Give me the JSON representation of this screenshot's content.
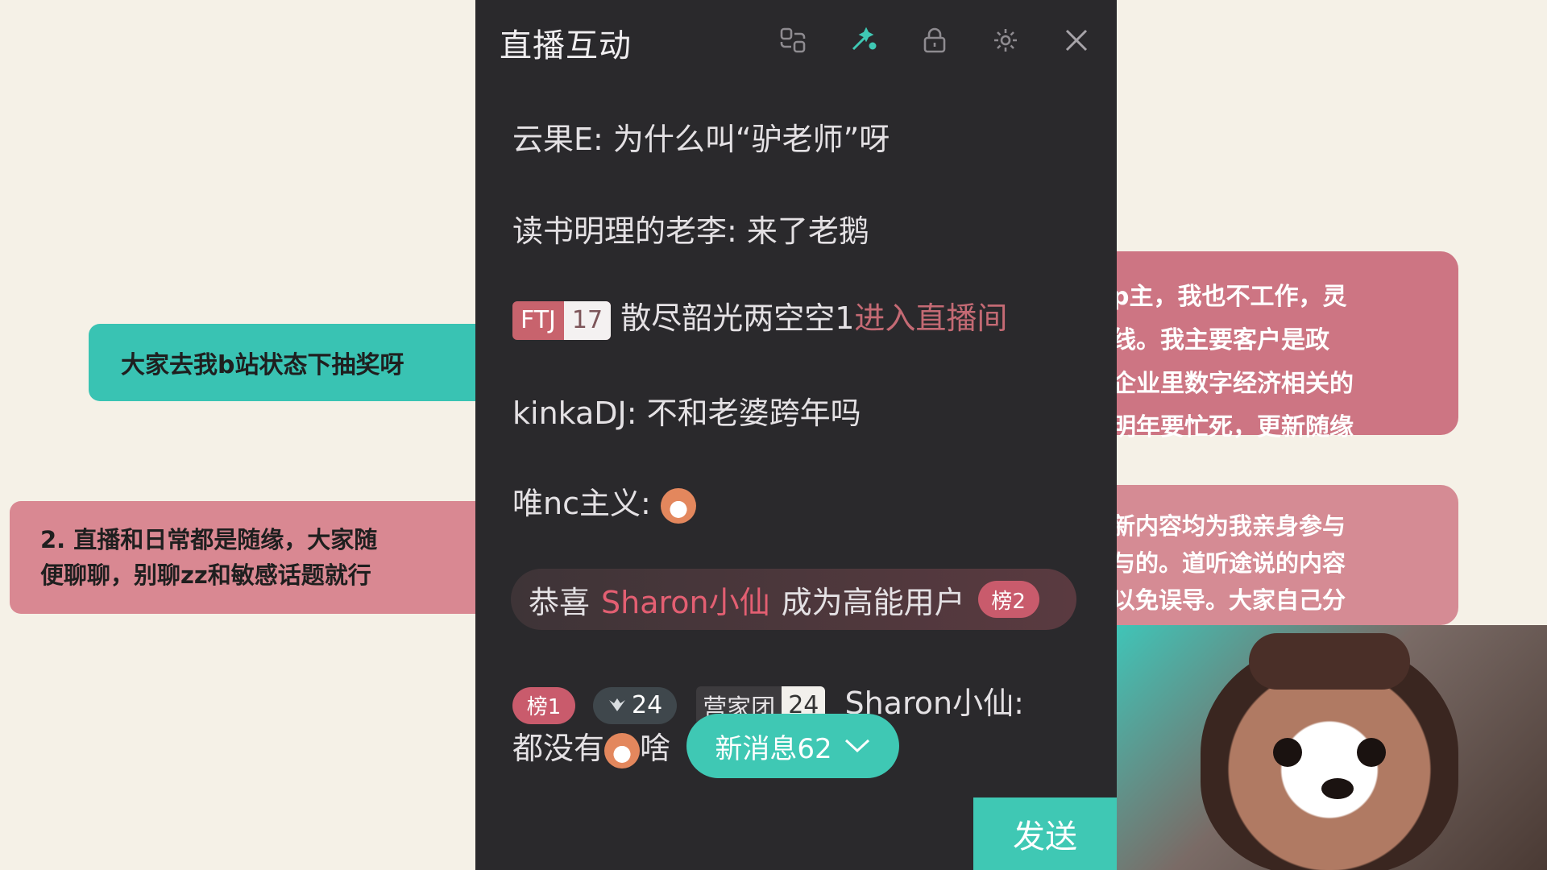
{
  "background": {
    "note_teal": "大家去我b站状态下抽奖呀",
    "note_left": "2. 直播和日常都是随缘，大家随\n便聊聊，别聊zz和敏感话题就行",
    "note_right_1": "p主，我也不工作，灵\n线。我主要客户是政\n企业里数字经济相关的\n明年要忙死，更新随缘",
    "note_right_2": "新内容均为我亲身参与\n与的。道听途说的内容\n以免误导。大家自己分"
  },
  "panel": {
    "title": "直播互动",
    "icons": [
      "pop-out-icon",
      "magic-icon",
      "lock-icon",
      "gear-icon",
      "close-icon"
    ]
  },
  "messages": [
    {
      "text": "云果E: 为什么叫“驴老师”呀"
    },
    {
      "text": "读书明理的老李: 来了老鹅"
    },
    {
      "badge_name": "FTJ",
      "badge_level": "17",
      "user": "散尽韶光两空空1",
      "action": "进入直播间"
    },
    {
      "text": "kinkaDJ: 不和老婆跨年吗"
    },
    {
      "text": "唯nc主义:"
    }
  ],
  "congrats": {
    "prefix": "恭喜",
    "user": "Sharon小仙",
    "suffix": "成为高能用户",
    "rank_badge": "榜2"
  },
  "last_message": {
    "rank_badge": "榜1",
    "guard_level": "24",
    "medal_name": "营家团",
    "medal_level": "24",
    "user": "Sharon小仙:",
    "text": "都没有",
    "text_tail": "啥"
  },
  "new_messages_button": "新消息62",
  "send_button": "发送",
  "colors": {
    "panel_bg": "#2a292c",
    "accent_teal": "#3fc8b4",
    "accent_red": "#c8636d"
  }
}
